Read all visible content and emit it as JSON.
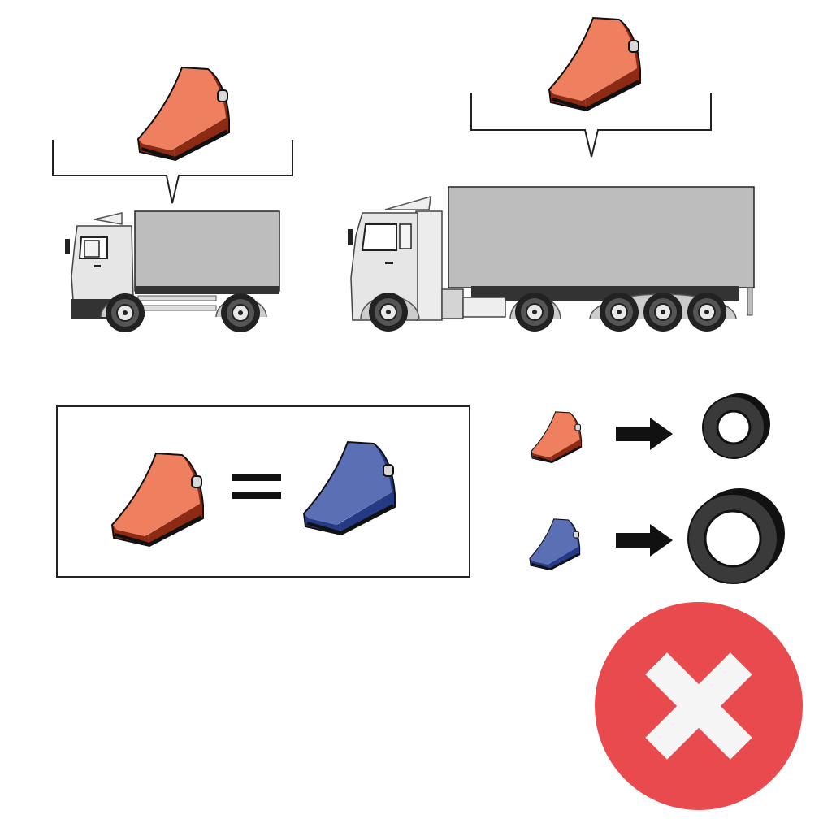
{
  "colors": {
    "chock_orange_top": "#ee8060",
    "chock_orange_side": "#8c2a14",
    "chock_blue_top": "#5a6fb4",
    "chock_blue_side": "#243a84",
    "truck_body": "#bdbdbd",
    "cab": "#e6e6e6",
    "tire": "#333333",
    "reject_circle": "#e84a4e",
    "reject_cross": "#f5f5f5",
    "outline": "#111111"
  },
  "diagram": {
    "scenes": [
      {
        "vehicle": "rigid-truck",
        "chock": "orange-chock"
      },
      {
        "vehicle": "semi-trailer-truck",
        "chock": "orange-chock"
      }
    ],
    "equivalence": {
      "left": "orange-chock",
      "right": "blue-chock",
      "operator": "equals"
    },
    "mappings": [
      {
        "chock": "orange-chock",
        "arrow": "arrow-right",
        "result": "small-tire"
      },
      {
        "chock": "blue-chock",
        "arrow": "arrow-right",
        "result": "large-tire"
      }
    ],
    "verdict": {
      "icon": "cross-icon",
      "meaning": "incorrect"
    }
  }
}
